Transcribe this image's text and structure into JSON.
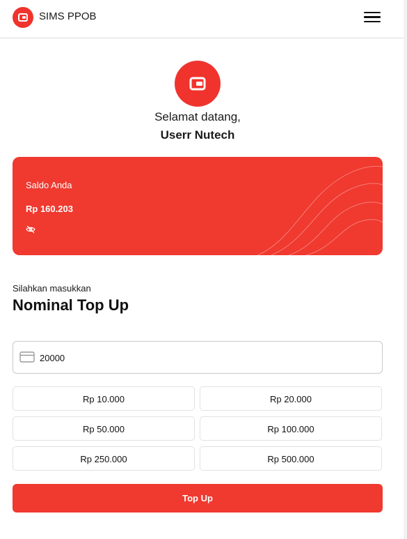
{
  "header": {
    "brand": "SIMS PPOB",
    "logo_icon": "wallet-icon",
    "menu_icon": "hamburger-menu-icon"
  },
  "profile": {
    "greeting": "Selamat datang,",
    "name": "Userr Nutech",
    "avatar_icon": "wallet-icon"
  },
  "balance_card": {
    "label": "Saldo Anda",
    "amount": "Rp 160.203",
    "visibility_icon": "eye-off-icon"
  },
  "topup": {
    "prompt": "Silahkan masukkan",
    "title": "Nominal Top Up",
    "input_icon": "credit-card-icon",
    "input_value": "20000",
    "presets": [
      "Rp 10.000",
      "Rp 20.000",
      "Rp 50.000",
      "Rp 100.000",
      "Rp 250.000",
      "Rp 500.000"
    ],
    "submit_label": "Top Up"
  },
  "colors": {
    "accent": "#f0392f",
    "border": "#e2e2e2"
  }
}
